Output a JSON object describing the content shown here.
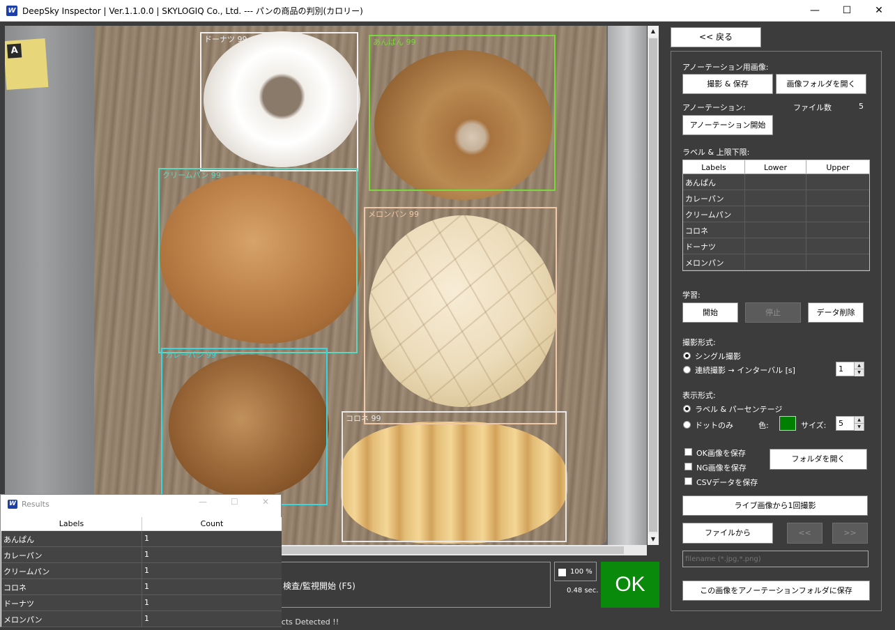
{
  "window": {
    "title": "DeepSky Inspector | Ver.1.1.0.0 | SKYLOGIQ Co., Ltd. --- パンの商品の判別(カロリー)",
    "minimize": "—",
    "maximize": "☐",
    "close": "✕"
  },
  "image": {
    "detections": [
      {
        "label": "ドーナツ 99",
        "color": "#f0f0f0"
      },
      {
        "label": "あんぱん 99",
        "color": "#7ad93a"
      },
      {
        "label": "クリームパン 99",
        "color": "#5fd6c0"
      },
      {
        "label": "メロンパン 99",
        "color": "#f0c8a8"
      },
      {
        "label": "カレーパン 99",
        "color": "#38d6e0"
      },
      {
        "label": "コロネ 99",
        "color": "#e8e8e8"
      }
    ]
  },
  "bottom": {
    "inspect_label": "検査/監視開始 (F5)",
    "percent_label": "100 %",
    "time_label": "0.48 sec.",
    "result_badge": "OK",
    "status": "ects Detected !!"
  },
  "results_window": {
    "title": "Results",
    "columns": [
      "Labels",
      "Count"
    ],
    "rows": [
      {
        "label": "あんぱん",
        "count": "1"
      },
      {
        "label": "カレーパン",
        "count": "1"
      },
      {
        "label": "クリームパン",
        "count": "1"
      },
      {
        "label": "コロネ",
        "count": "1"
      },
      {
        "label": "ドーナツ",
        "count": "1"
      },
      {
        "label": "メロンパン",
        "count": "1"
      }
    ]
  },
  "panel": {
    "back_button": "<< 戻る",
    "annotation_images_heading": "アノーテーション用画像:",
    "capture_save_button": "撮影 & 保存",
    "open_image_folder_button": "画像フォルダを開く",
    "annotation_heading": "アノーテーション:",
    "file_count_label": "ファイル数",
    "file_count_value": "5",
    "start_annotation_button": "アノーテーション開始",
    "limits_heading": "ラベル & 上限下限:",
    "limits_columns": [
      "Labels",
      "Lower",
      "Upper"
    ],
    "limits_rows": [
      "あんぱん",
      "カレーパン",
      "クリームパン",
      "コロネ",
      "ドーナツ",
      "メロンパン"
    ],
    "training_heading": "学習:",
    "train_start_button": "開始",
    "train_stop_button": "停止",
    "delete_data_button": "データ削除",
    "capture_mode_heading": "撮影形式:",
    "single_capture_label": "シングル撮影",
    "continuous_capture_label": "連続撮影 → インターバル [s]",
    "interval_value": "1",
    "display_mode_heading": "表示形式:",
    "label_percent_label": "ラベル & パーセンテージ",
    "dot_only_label": "ドットのみ",
    "color_label": "色:",
    "dot_color": "#008000",
    "size_label": "サイズ:",
    "size_value": "5",
    "save_ok_label": "OK画像を保存",
    "save_ng_label": "NG画像を保存",
    "save_csv_label": "CSVデータを保存",
    "open_folder_button": "フォルダを開く",
    "single_live_capture_button": "ライブ画像から1回撮影",
    "from_file_button": "ファイルから",
    "prev_button": "<<",
    "next_button": ">>",
    "filename_placeholder": "filename (*.jpg,*.png)",
    "save_to_annotation_button": "この画像をアノーテーションフォルダに保存"
  }
}
